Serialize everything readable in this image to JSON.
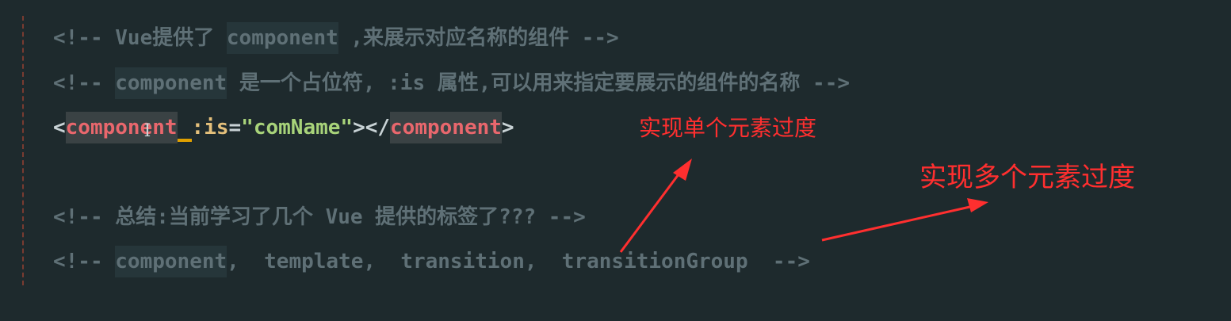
{
  "editor": {
    "line1": {
      "a": "<!-- Vue提供了 ",
      "b": "component",
      "c": " ,来展示对应名称的组件 -->"
    },
    "line2": {
      "a": "<!-- ",
      "b": "component",
      "c": " 是一个占位符, :is 属性,可以用来指定要展示的组件的名称 -->"
    },
    "line3": {
      "open_lt": "<",
      "open_tag": "component",
      "space": " ",
      "attr": ":is",
      "eq": "=",
      "value": "\"comName\"",
      "close_open": "></",
      "close_tag": "component",
      "close_gt": ">"
    },
    "line4": {
      "text": "<!-- 总结:当前学习了几个 Vue 提供的标签了??? -->"
    },
    "line5": {
      "a": "<!-- ",
      "b": "component",
      "c": ",  template,  transition,  transitionGroup  -->"
    }
  },
  "annotations": {
    "single": "实现单个元素过度",
    "multiple": "实现多个元素过度",
    "color": "#ff2f2f"
  },
  "colors": {
    "background": "#1e2a2d",
    "comment": "#5f7076",
    "tag": "#e9676d",
    "attribute": "#e5c07b",
    "string": "#a8d37a"
  },
  "icons": {
    "text_cursor": "i-beam-cursor-icon"
  }
}
